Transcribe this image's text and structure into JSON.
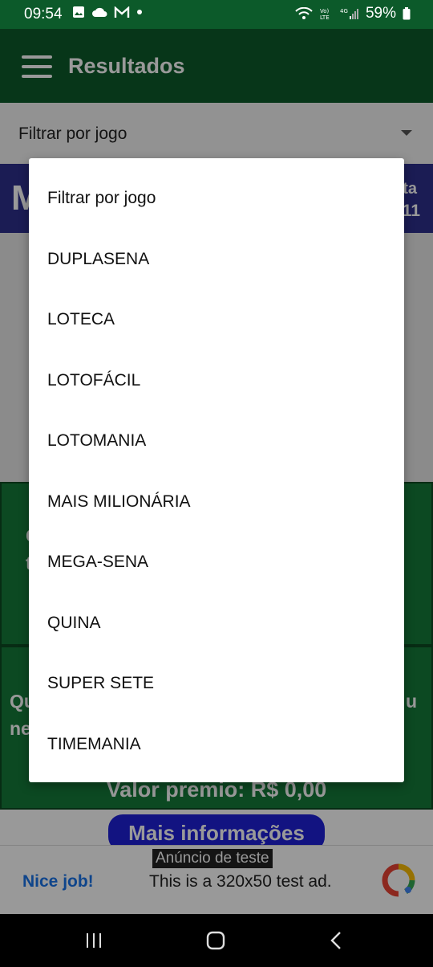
{
  "status_bar": {
    "time": "09:54",
    "battery": "59%"
  },
  "app_bar": {
    "title": "Resultados"
  },
  "filter": {
    "label": "Filtrar por jogo"
  },
  "background": {
    "header_letter": "M",
    "header_right_top": "ta",
    "header_right_bottom": "11",
    "box1_frag_a": "C",
    "box1_frag_b": "t",
    "box2_left_a": "Qu",
    "box2_left_b": "ne",
    "box2_right": "u",
    "valor_premio": "Valor premio: R$ 0,00",
    "more_info": "Mais informações"
  },
  "ad": {
    "label": "Anúncio de teste",
    "headline": "Nice job!",
    "body": "This is a 320x50 test ad."
  },
  "dropdown": {
    "options": [
      "Filtrar por jogo",
      "DUPLASENA",
      "LOTECA",
      "LOTOFÁCIL",
      "LOTOMANIA",
      "MAIS MILIONÁRIA",
      "MEGA-SENA",
      "QUINA",
      "SUPER SETE",
      "TIMEMANIA"
    ]
  },
  "colors": {
    "app_green": "#0c5a2a",
    "header_blue": "#2e2f8c",
    "button_blue": "#1e21d8"
  }
}
